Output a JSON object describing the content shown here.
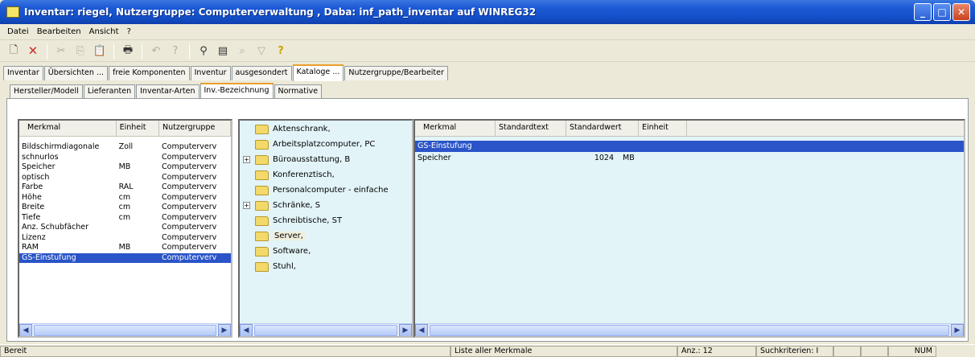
{
  "window": {
    "title": "Inventar: riegel, Nutzergruppe: Computerverwaltung , Daba: inf_path_inventar auf WINREG32"
  },
  "menu": [
    "Datei",
    "Bearbeiten",
    "Ansicht",
    "?"
  ],
  "main_tabs": [
    "Inventar",
    "Übersichten ...",
    "freie Komponenten",
    "Inventur",
    "ausgesondert",
    "Kataloge ...",
    "Nutzergruppe/Bearbeiter"
  ],
  "sub_tabs": [
    "Hersteller/Modell",
    "Lieferanten",
    "Inventar-Arten",
    "Inv.-Bezeichnung",
    "Normative"
  ],
  "left_pane": {
    "headers": [
      "Merkmal",
      "Einheit",
      "Nutzergruppe"
    ],
    "rows": [
      [
        "Bildschirmdiagonale",
        "Zoll",
        "Computerverv"
      ],
      [
        "schnurlos",
        "",
        "Computerverv"
      ],
      [
        "Speicher",
        "MB",
        "Computerverv"
      ],
      [
        "optisch",
        "",
        "Computerverv"
      ],
      [
        "Farbe",
        "RAL",
        "Computerverv"
      ],
      [
        "Höhe",
        "cm",
        "Computerverv"
      ],
      [
        "Breite",
        "cm",
        "Computerverv"
      ],
      [
        "Tiefe",
        "cm",
        "Computerverv"
      ],
      [
        "Anz. Schubfächer",
        "",
        "Computerverv"
      ],
      [
        "Lizenz",
        "",
        "Computerverv"
      ],
      [
        "RAM",
        "MB",
        "Computerverv"
      ],
      [
        "GS-Einstufung",
        "",
        "Computerverv"
      ]
    ]
  },
  "tree": [
    {
      "label": "Aktenschrank,",
      "expandable": false
    },
    {
      "label": "Arbeitsplatzcomputer, PC",
      "expandable": false
    },
    {
      "label": "Büroausstattung, B",
      "expandable": true
    },
    {
      "label": "Konferenztisch,",
      "expandable": false
    },
    {
      "label": "Personalcomputer - einfache",
      "expandable": false
    },
    {
      "label": "Schränke, S",
      "expandable": true
    },
    {
      "label": "Schreibtische, ST",
      "expandable": false
    },
    {
      "label": "Server,",
      "expandable": false
    },
    {
      "label": "Software,",
      "expandable": false
    },
    {
      "label": "Stuhl,",
      "expandable": false
    }
  ],
  "right_pane": {
    "headers": [
      "Merkmal",
      "Standardtext",
      "Standardwert",
      "Einheit"
    ],
    "group": "GS-Einstufung",
    "rows": [
      [
        "Speicher",
        "",
        "1024",
        "MB"
      ]
    ]
  },
  "status": {
    "left": "Bereit",
    "center": "Liste aller Merkmale",
    "count": "Anz.: 12",
    "criteria": "Suchkriterien: I",
    "num": "NUM"
  }
}
